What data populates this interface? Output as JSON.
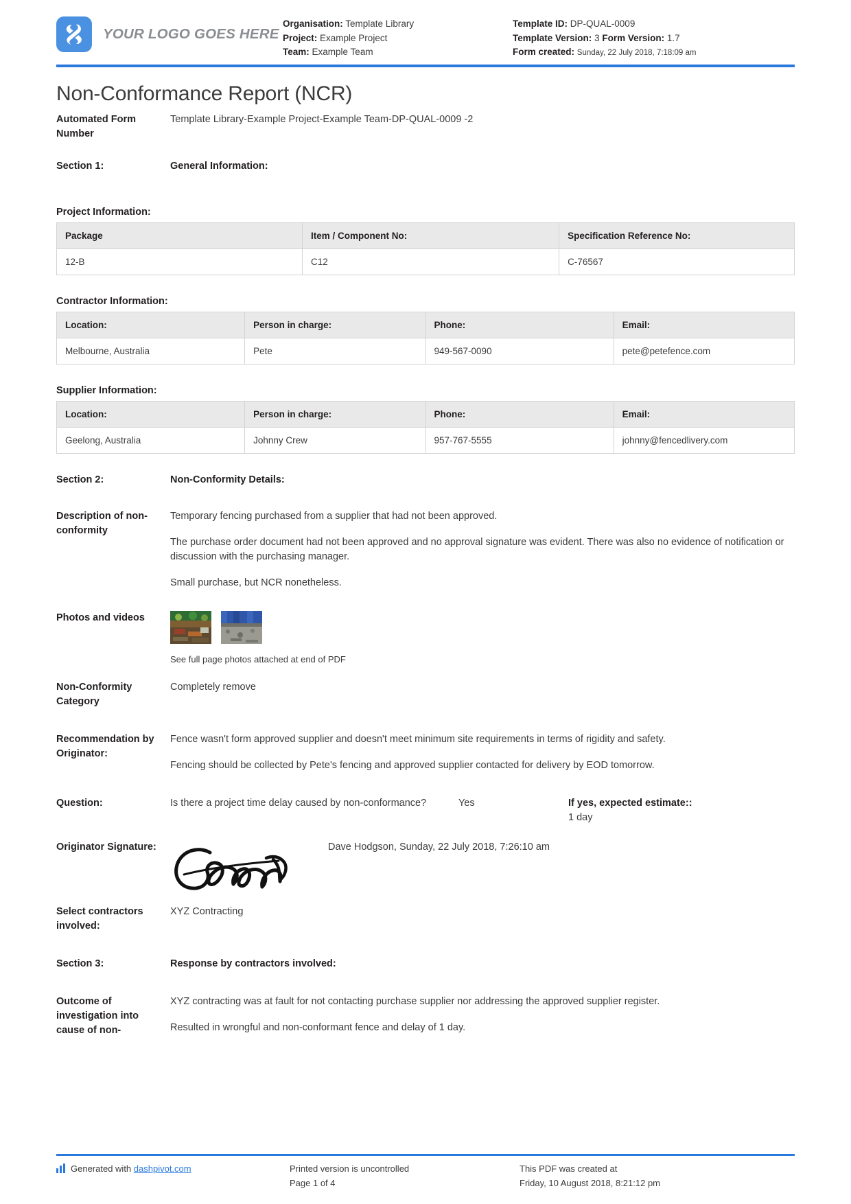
{
  "header": {
    "logo_text": "YOUR LOGO GOES HERE",
    "organisation_label": "Organisation:",
    "organisation_value": "Template Library",
    "project_label": "Project:",
    "project_value": "Example Project",
    "team_label": "Team:",
    "team_value": "Example Team",
    "template_id_label": "Template ID:",
    "template_id_value": "DP-QUAL-0009",
    "template_version_label": "Template Version:",
    "template_version_value": "3",
    "form_version_label": "Form Version:",
    "form_version_value": "1.7",
    "form_created_label": "Form created:",
    "form_created_value": "Sunday, 22 July 2018, 7:18:09 am"
  },
  "title": "Non-Conformance Report (NCR)",
  "automated_form": {
    "label": "Automated Form Number",
    "value": "Template Library-Example Project-Example Team-DP-QUAL-0009   -2"
  },
  "section1": {
    "label": "Section 1:",
    "value": "General Information:"
  },
  "project_information": {
    "heading": "Project Information:",
    "columns": [
      "Package",
      "Item / Component No:",
      "Specification Reference No:"
    ],
    "rows": [
      [
        "12-B",
        "C12",
        "C-76567"
      ]
    ]
  },
  "contractor_information": {
    "heading": "Contractor Information:",
    "columns": [
      "Location:",
      "Person in charge:",
      "Phone:",
      "Email:"
    ],
    "rows": [
      [
        "Melbourne, Australia",
        "Pete",
        "949-567-0090",
        "pete@petefence.com"
      ]
    ]
  },
  "supplier_information": {
    "heading": "Supplier Information:",
    "columns": [
      "Location:",
      "Person in charge:",
      "Phone:",
      "Email:"
    ],
    "rows": [
      [
        "Geelong, Australia",
        "Johnny Crew",
        "957-767-5555",
        "johnny@fencedlivery.com"
      ]
    ]
  },
  "section2": {
    "label": "Section 2:",
    "value": "Non-Conformity Details:"
  },
  "description": {
    "label": "Description of non-conformity",
    "paragraphs": [
      "Temporary fencing purchased from a supplier that had not been approved.",
      "The purchase order document had not been approved and no approval signature was evident. There was also no evidence of notification or discussion with the purchasing manager.",
      "Small purchase, but NCR nonetheless."
    ]
  },
  "photos": {
    "label": "Photos and videos",
    "caption": "See full page photos attached at end of PDF"
  },
  "category": {
    "label": "Non-Conformity Category",
    "value": "Completely remove"
  },
  "recommendation": {
    "label": "Recommendation by Originator:",
    "paragraphs": [
      "Fence wasn't form approved supplier and doesn't meet minimum site requirements in terms of rigidity and safety.",
      "Fencing should be collected by Pete's fencing and approved supplier contacted for delivery by EOD tomorrow."
    ]
  },
  "question": {
    "label": "Question:",
    "text": "Is there a project time delay caused by non-conformance?",
    "answer": "Yes",
    "estimate_label": "If yes, expected estimate::",
    "estimate_value": "1 day"
  },
  "signature": {
    "label": "Originator Signature:",
    "meta": "Dave Hodgson, Sunday, 22 July 2018, 7:26:10 am"
  },
  "contractors": {
    "label": "Select contractors involved:",
    "value": "XYZ Contracting"
  },
  "section3": {
    "label": "Section 3:",
    "value": "Response by contractors involved:"
  },
  "outcome": {
    "label": "Outcome of investigation into cause of non-",
    "paragraphs": [
      "XYZ contracting was at fault for not contacting purchase supplier nor addressing the approved supplier register.",
      "Resulted in wrongful and non-conformant fence and delay of 1 day."
    ]
  },
  "footer": {
    "generated_prefix": "Generated with ",
    "generated_link": "dashpivot.com",
    "printed_line1": "Printed version is uncontrolled",
    "printed_line2": "Page 1 of 4",
    "created_line1": "This PDF was created at",
    "created_line2": "Friday, 10 August 2018, 8:21:12 pm"
  },
  "colors": {
    "accent_blue": "#2a7ade",
    "logo_blue": "#4b91e2",
    "table_header": "#e9e9e9"
  }
}
